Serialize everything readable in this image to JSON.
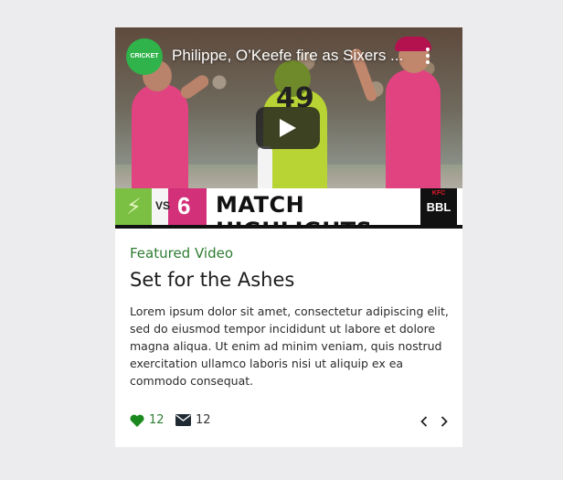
{
  "video": {
    "channel_logo_text": "CRICKET",
    "title": "Philippe, O’Keefe fire as Sixers ...",
    "player_number": "49",
    "banner_vs": "VS",
    "banner_text": "MATCH HIGHLIGHTS",
    "banner_badge": "BBL",
    "banner_badge_sponsor": "KFC",
    "team2_mark": "6"
  },
  "card": {
    "eyebrow": "Featured Video",
    "title": "Set for the Ashes",
    "body": "Lorem ipsum dolor sit amet, consectetur adipiscing elit, sed do eiusmod tempor incididunt ut labore et dolore magna aliqua. Ut enim ad minim veniam, quis nostrud exercitation ullamco laboris nisi ut aliquip ex ea commodo consequat."
  },
  "footer": {
    "likes": "12",
    "messages": "12"
  },
  "colors": {
    "accent_green": "#2e7d32",
    "background": "#ececee",
    "sixers_pink": "#e0437f",
    "thunder_green": "#b7d334"
  },
  "icons": {
    "like": "heart-icon",
    "messages": "envelope-icon",
    "prev": "chevron-left-icon",
    "next": "chevron-right-icon",
    "play": "play-icon",
    "menu": "kebab-menu-icon"
  }
}
